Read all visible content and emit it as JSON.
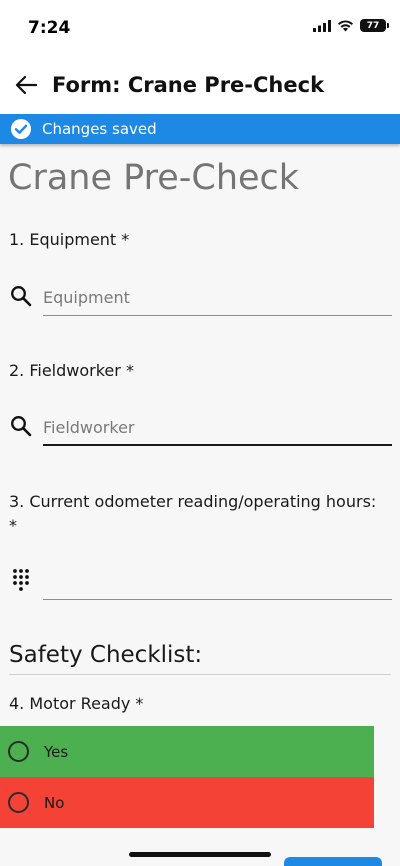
{
  "status_bar": {
    "time": "7:24",
    "battery": "77"
  },
  "header": {
    "title": "Form: Crane Pre-Check"
  },
  "banner": {
    "text": "Changes saved"
  },
  "form": {
    "title": "Crane Pre-Check",
    "questions": [
      {
        "label": "1. Equipment *",
        "placeholder": "Equipment",
        "value": ""
      },
      {
        "label": "2. Fieldworker *",
        "placeholder": "Fieldworker",
        "value": ""
      },
      {
        "label": "3. Current odometer reading/operating hours:",
        "label_line2": "*",
        "placeholder": "",
        "value": ""
      }
    ],
    "section": {
      "title": "Safety Checklist:"
    },
    "q4": {
      "label": "4. Motor Ready *",
      "options": [
        {
          "label": "Yes",
          "color": "#4caf50",
          "selected": false
        },
        {
          "label": "No",
          "color": "#f44336",
          "selected": false
        }
      ]
    }
  },
  "colors": {
    "accent": "#1e88e5",
    "yes": "#4caf50",
    "no": "#f44336"
  }
}
